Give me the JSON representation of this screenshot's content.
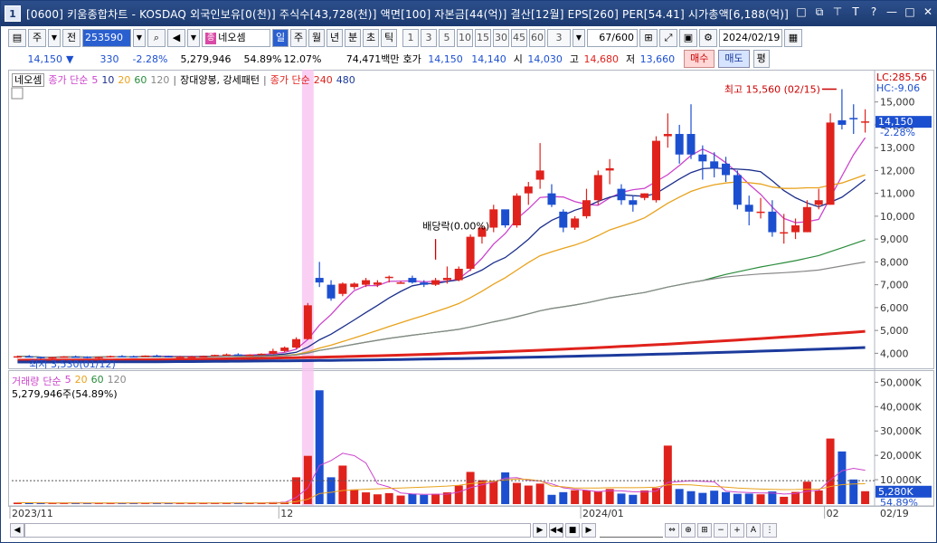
{
  "window": {
    "app_number": "1",
    "title": "[0600] 키움종합차트 - KOSDAQ 외국인보유[0(천)] 주식수[43,728(천)] 액면[100] 자본금[44(억)] 결산[12월] EPS[260] PER[54.41] 시가총액[6,188(억)]",
    "buttons": [
      "□",
      "⧉",
      "⊤",
      "T",
      "?",
      "—",
      "□",
      "✕"
    ]
  },
  "toolbar": {
    "period_label": "주",
    "prev_label": "전",
    "stock_code": "253590",
    "stock_tag": "종",
    "stock_name": "네오셈",
    "period_buttons": [
      "일",
      "주",
      "월",
      "년",
      "분",
      "초",
      "틱"
    ],
    "interval_buttons": [
      "1",
      "3",
      "5",
      "10",
      "15",
      "30",
      "45",
      "60"
    ],
    "interval_value": "3",
    "count": "67",
    "count_total": "/600",
    "date": "2024/02/19"
  },
  "quote": {
    "price": "14,150",
    "arrow": "▼",
    "change": "330",
    "change_pct": "-2.28%",
    "volume": "5,279,946",
    "volume_ratio": "54.89%",
    "turnover": "12.07%",
    "amount": "74,471백만",
    "ask_label": "호가",
    "ask1": "14,150",
    "ask2": "14,140",
    "open_label": "시",
    "open": "14,030",
    "high_label": "고",
    "high": "14,680",
    "low_label": "저",
    "low": "13,660",
    "buy_label": "매수",
    "sell_label": "매도",
    "avg_label": "평"
  },
  "legend": {
    "stock": "네오셈",
    "ma_label": "종가 단순",
    "ma_periods": [
      "5",
      "10",
      "20",
      "60",
      "120"
    ],
    "pattern": "장대양봉, 강세패턴",
    "ma2_label": "종가 단순",
    "ma2_periods": [
      "240",
      "480"
    ],
    "ma_colors": [
      "#cc44cc",
      "#1c2f8c",
      "#e8a21c",
      "#2a8c3c",
      "#888888"
    ],
    "ma2_colors": [
      "#e0221c",
      "#1c3a9c"
    ]
  },
  "annotations": {
    "high": "최고 15,560 (02/15)",
    "dividend": "배당락(0.00%)",
    "low": "최저 3,530(01/12)"
  },
  "price_axis": {
    "ticks": [
      "15,000",
      "14,000",
      "13,000",
      "12,000",
      "11,000",
      "10,000",
      "9,000",
      "8,000",
      "7,000",
      "6,000",
      "5,000",
      "4,000"
    ],
    "lc": "LC:285.56",
    "hc": "HC:-9.06",
    "current": "14,150",
    "current_pct": "-2.28%"
  },
  "volume": {
    "legend_label": "거래량",
    "ma_label": "단순",
    "ma_periods": [
      "5",
      "20",
      "60",
      "120"
    ],
    "info": "5,279,946주(54.89%)",
    "ticks": [
      "50,000K",
      "40,000K",
      "30,000K",
      "20,000K",
      "10,000K"
    ],
    "current": "5,280K",
    "current_pct": "54.89%"
  },
  "x_axis": {
    "labels": [
      "2023/11",
      "12",
      "2024/01",
      "02"
    ],
    "right_label": "02/19"
  },
  "chart_data": {
    "type": "candlestick",
    "price_range": [
      3500,
      15700
    ],
    "volume_range": [
      0,
      52000
    ],
    "candles": [
      [
        3850,
        3900,
        3800,
        3870,
        600
      ],
      [
        3870,
        3920,
        3820,
        3840,
        500
      ],
      [
        3840,
        3860,
        3760,
        3790,
        450
      ],
      [
        3790,
        3850,
        3750,
        3830,
        420
      ],
      [
        3830,
        3880,
        3800,
        3860,
        400
      ],
      [
        3860,
        3900,
        3820,
        3850,
        380
      ],
      [
        3850,
        3870,
        3780,
        3800,
        400
      ],
      [
        3800,
        3850,
        3760,
        3840,
        420
      ],
      [
        3840,
        3900,
        3810,
        3880,
        450
      ],
      [
        3880,
        3920,
        3850,
        3870,
        430
      ],
      [
        3870,
        3900,
        3830,
        3860,
        400
      ],
      [
        3860,
        3910,
        3840,
        3900,
        420
      ],
      [
        3900,
        3940,
        3860,
        3880,
        440
      ],
      [
        3880,
        3900,
        3820,
        3840,
        430
      ],
      [
        3840,
        3880,
        3800,
        3850,
        410
      ],
      [
        3850,
        3880,
        3820,
        3860,
        400
      ],
      [
        3860,
        3900,
        3830,
        3880,
        420
      ],
      [
        3880,
        3940,
        3860,
        3930,
        460
      ],
      [
        3930,
        3990,
        3900,
        3950,
        500
      ],
      [
        3950,
        4000,
        3910,
        3920,
        480
      ],
      [
        3920,
        3960,
        3880,
        3940,
        450
      ],
      [
        3940,
        4000,
        3920,
        3980,
        500
      ],
      [
        3980,
        4200,
        3960,
        4100,
        800
      ],
      [
        4100,
        4300,
        4050,
        4250,
        900
      ],
      [
        4250,
        4700,
        4200,
        4620,
        11000
      ],
      [
        4620,
        6200,
        4600,
        6100,
        19800
      ],
      [
        7300,
        8000,
        6900,
        7100,
        46700
      ],
      [
        7000,
        7200,
        6300,
        6400,
        11000
      ],
      [
        6600,
        7100,
        6500,
        7050,
        15800
      ],
      [
        6900,
        7100,
        6800,
        7050,
        6000
      ],
      [
        7000,
        7300,
        6900,
        7200,
        4800
      ],
      [
        7000,
        7200,
        6900,
        7100,
        4000
      ],
      [
        7300,
        7400,
        7100,
        7350,
        4500
      ],
      [
        7100,
        7150,
        7050,
        7100,
        3500
      ],
      [
        7300,
        7400,
        7050,
        7100,
        4200
      ],
      [
        7100,
        7200,
        6900,
        7000,
        3800
      ],
      [
        7000,
        7300,
        6950,
        7200,
        4200
      ],
      [
        7200,
        7800,
        7050,
        7300,
        4800
      ],
      [
        7200,
        7800,
        7150,
        7700,
        7600
      ],
      [
        7700,
        9200,
        7600,
        9100,
        13200
      ],
      [
        9100,
        9600,
        8800,
        9500,
        9800
      ],
      [
        9500,
        10500,
        9300,
        10300,
        9600
      ],
      [
        10300,
        10200,
        9500,
        9600,
        13000
      ],
      [
        9600,
        11000,
        9500,
        10900,
        8700
      ],
      [
        11000,
        11500,
        10500,
        11300,
        7600
      ],
      [
        11600,
        13200,
        11200,
        12000,
        8400
      ],
      [
        11000,
        11400,
        10400,
        10500,
        3800
      ],
      [
        10200,
        10300,
        9300,
        9500,
        4900
      ],
      [
        9500,
        10000,
        9400,
        9900,
        5700
      ],
      [
        10000,
        11200,
        9900,
        10700,
        5600
      ],
      [
        10700,
        12000,
        10500,
        11800,
        5300
      ],
      [
        12000,
        12500,
        11400,
        12100,
        6200
      ],
      [
        11200,
        11400,
        10500,
        10700,
        4300
      ],
      [
        10700,
        10900,
        10200,
        10500,
        3800
      ],
      [
        10800,
        11000,
        10700,
        11000,
        5600
      ],
      [
        10700,
        13500,
        10600,
        13300,
        6600
      ],
      [
        13500,
        14500,
        13000,
        13600,
        24000
      ],
      [
        13600,
        14000,
        12300,
        12700,
        6200
      ],
      [
        13600,
        14900,
        12500,
        12700,
        5300
      ],
      [
        12700,
        13100,
        11600,
        12400,
        4600
      ],
      [
        12400,
        12800,
        11700,
        12100,
        5500
      ],
      [
        12300,
        12600,
        11500,
        11800,
        4900
      ],
      [
        11800,
        12000,
        10300,
        10500,
        4200
      ],
      [
        10500,
        10900,
        9600,
        10200,
        4300
      ],
      [
        10200,
        10800,
        9900,
        10200,
        4000
      ],
      [
        10200,
        10700,
        9100,
        9300,
        5200
      ],
      [
        9300,
        10100,
        8800,
        9300,
        3000
      ],
      [
        9300,
        9900,
        9000,
        9600,
        5000
      ],
      [
        9300,
        10700,
        9300,
        10400,
        9200
      ],
      [
        10500,
        11200,
        10300,
        10700,
        5600
      ],
      [
        10500,
        14500,
        10500,
        14100,
        26900
      ],
      [
        14200,
        15560,
        13800,
        14000,
        21600
      ],
      [
        14300,
        14900,
        13600,
        14250,
        10100
      ],
      [
        14150,
        14680,
        13660,
        14150,
        5280
      ]
    ]
  }
}
